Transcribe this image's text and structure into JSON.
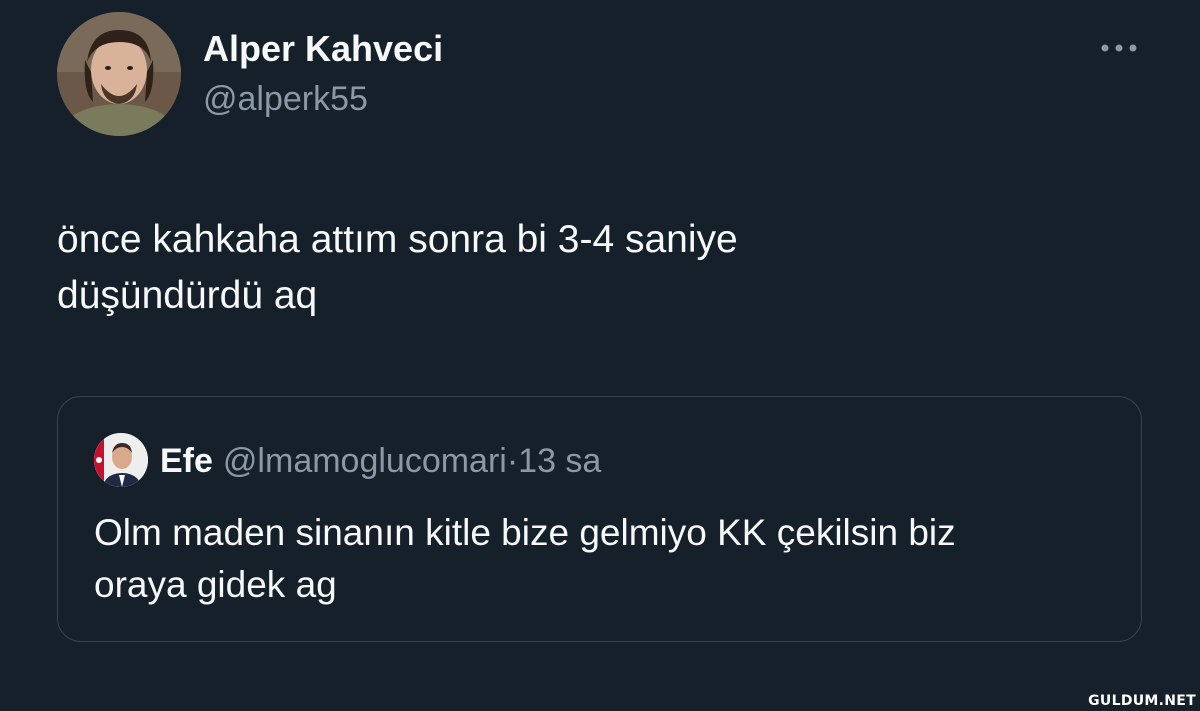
{
  "colors": {
    "background": "#15202b",
    "primary_text": "#f7f9f9",
    "secondary_text": "#8b98a5",
    "border": "#38444d"
  },
  "tweet": {
    "author": {
      "name": "Alper Kahveci",
      "handle": "@alperk55",
      "avatar_icon": "profile-photo"
    },
    "more_icon": "more-options-ellipsis-icon",
    "text_line_1": "önce kahkaha attım sonra bi 3-4 saniye",
    "text_line_2": "düşündürdü aq"
  },
  "quoted_tweet": {
    "author": {
      "name": "Efe",
      "handle": "@lmamoglucomari",
      "avatar_icon": "profile-photo"
    },
    "separator": "·",
    "time": "13 sa",
    "text_line_1": "Olm maden sinanın kitle bize gelmiyo KK çekilsin biz",
    "text_line_2": "oraya gidek ag"
  },
  "watermark": "GULDUM.NET"
}
